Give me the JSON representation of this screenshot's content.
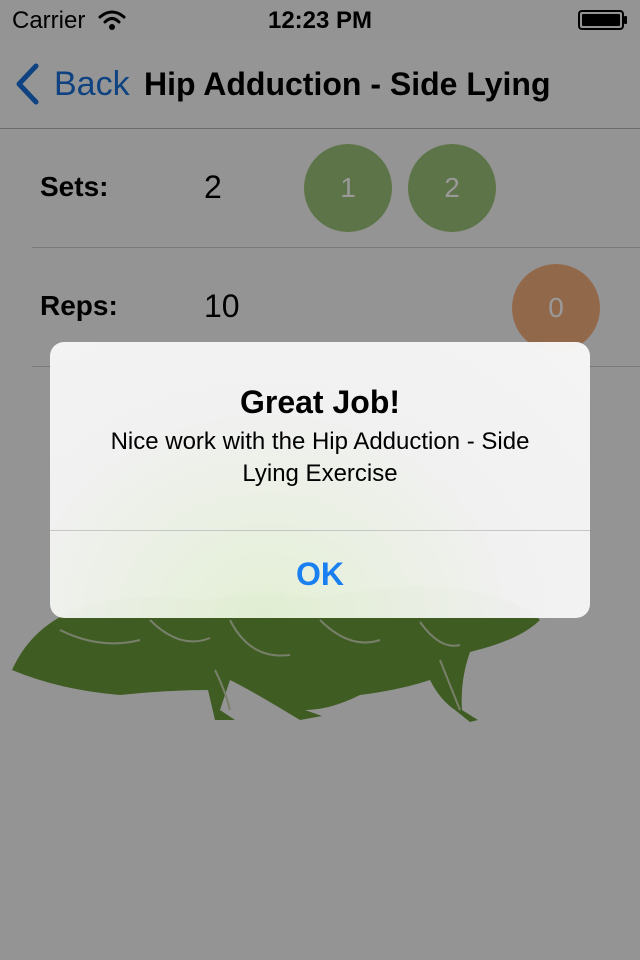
{
  "status_bar": {
    "carrier": "Carrier",
    "time": "12:23 PM"
  },
  "nav": {
    "back_label": "Back",
    "title": "Hip Adduction - Side Lying"
  },
  "sets": {
    "label": "Sets:",
    "value": "2",
    "buttons": [
      "1",
      "2"
    ]
  },
  "reps": {
    "label": "Reps:",
    "value": "10",
    "counter": "0"
  },
  "alert": {
    "title": "Great Job!",
    "message": "Nice work with the Hip Adduction - Side Lying Exercise",
    "ok_label": "OK"
  },
  "colors": {
    "accent": "#1a7ff0",
    "set_circle": "#9bc179",
    "rep_circle": "#f2b07c",
    "figure": "#6a9a3a"
  },
  "icons": [
    "wifi-icon",
    "battery-icon",
    "back-chevron-icon",
    "exercise-figure"
  ]
}
